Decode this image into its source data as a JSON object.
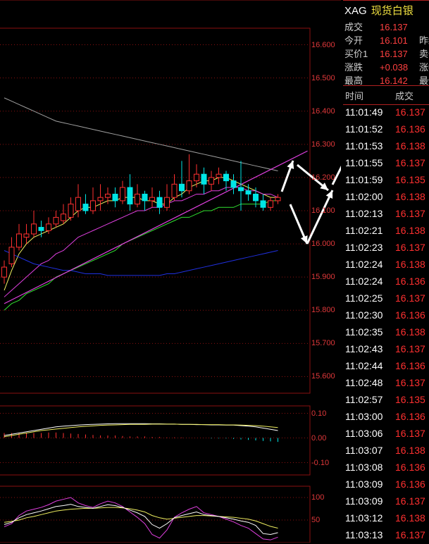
{
  "colors": {
    "up": "#ff3030",
    "down": "#00e5e5",
    "grid": "#8a1010",
    "axis": "#e0383a"
  },
  "header": {
    "symbol_code": "XAG",
    "symbol_name": "现货白银",
    "rows": [
      {
        "k": "成交",
        "v": "16.137",
        "x": ""
      },
      {
        "k": "今开",
        "v": "16.101",
        "x": "昨结"
      },
      {
        "k": "买价1",
        "v": "16.137",
        "x": "卖价"
      },
      {
        "k": "涨跌",
        "v": "+0.038",
        "x": "涨幅"
      },
      {
        "k": "最高",
        "v": "16.142",
        "x": "最低"
      }
    ]
  },
  "ticks_header": {
    "time": "时间",
    "price": "成交"
  },
  "ticks": [
    {
      "time": "11:01:49",
      "price": "16.137"
    },
    {
      "time": "11:01:52",
      "price": "16.136"
    },
    {
      "time": "11:01:53",
      "price": "16.138"
    },
    {
      "time": "11:01:55",
      "price": "16.137"
    },
    {
      "time": "11:01:59",
      "price": "16.135"
    },
    {
      "time": "11:02:00",
      "price": "16.138"
    },
    {
      "time": "11:02:13",
      "price": "16.137"
    },
    {
      "time": "11:02:21",
      "price": "16.138"
    },
    {
      "time": "11:02:23",
      "price": "16.137"
    },
    {
      "time": "11:02:24",
      "price": "16.138"
    },
    {
      "time": "11:02:24",
      "price": "16.136"
    },
    {
      "time": "11:02:25",
      "price": "16.137"
    },
    {
      "time": "11:02:30",
      "price": "16.136"
    },
    {
      "time": "11:02:35",
      "price": "16.138"
    },
    {
      "time": "11:02:43",
      "price": "16.137"
    },
    {
      "time": "11:02:44",
      "price": "16.136"
    },
    {
      "time": "11:02:48",
      "price": "16.137"
    },
    {
      "time": "11:02:57",
      "price": "16.135"
    },
    {
      "time": "11:03:00",
      "price": "16.136"
    },
    {
      "time": "11:03:06",
      "price": "16.137"
    },
    {
      "time": "11:03:07",
      "price": "16.138"
    },
    {
      "time": "11:03:08",
      "price": "16.136"
    },
    {
      "time": "11:03:09",
      "price": "16.136"
    },
    {
      "time": "11:03:09",
      "price": "16.137"
    },
    {
      "time": "11:03:12",
      "price": "16.138"
    },
    {
      "time": "11:03:13",
      "price": "16.137"
    }
  ],
  "price_axis": [
    "16.600",
    "16.500",
    "16.400",
    "16.300",
    "16.200",
    "16.100",
    "16.000",
    "15.900",
    "15.800",
    "15.700",
    "15.600"
  ],
  "macd_axis": [
    "0.10",
    "0.00",
    "-0.10"
  ],
  "kdj_axis": [
    "100",
    "50"
  ],
  "chart_data": {
    "type": "candlestick",
    "ylim": [
      15.55,
      16.65
    ],
    "candles": [
      [
        15.9,
        15.93,
        15.88,
        15.95
      ],
      [
        15.94,
        15.99,
        15.93,
        16.02
      ],
      [
        15.99,
        16.03,
        15.98,
        16.06
      ],
      [
        16.02,
        16.03,
        16.0,
        16.06
      ],
      [
        16.03,
        16.06,
        16.02,
        16.1
      ],
      [
        16.05,
        16.04,
        16.02,
        16.07
      ],
      [
        16.04,
        16.06,
        16.03,
        16.08
      ],
      [
        16.06,
        16.08,
        16.05,
        16.1
      ],
      [
        16.07,
        16.09,
        16.06,
        16.12
      ],
      [
        16.08,
        16.12,
        16.07,
        16.14
      ],
      [
        16.1,
        16.14,
        16.08,
        16.18
      ],
      [
        16.12,
        16.1,
        16.09,
        16.15
      ],
      [
        16.1,
        16.13,
        16.09,
        16.17
      ],
      [
        16.13,
        16.14,
        16.1,
        16.18
      ],
      [
        16.14,
        16.15,
        16.12,
        16.17
      ],
      [
        16.15,
        16.13,
        16.11,
        16.17
      ],
      [
        16.13,
        16.17,
        16.12,
        16.19
      ],
      [
        16.17,
        16.12,
        16.1,
        16.21
      ],
      [
        16.12,
        16.15,
        16.11,
        16.18
      ],
      [
        16.15,
        16.13,
        16.1,
        16.16
      ],
      [
        16.13,
        16.14,
        16.11,
        16.17
      ],
      [
        16.14,
        16.11,
        16.09,
        16.16
      ],
      [
        16.11,
        16.14,
        16.1,
        16.18
      ],
      [
        16.14,
        16.18,
        16.13,
        16.21
      ],
      [
        16.18,
        16.16,
        16.14,
        16.25
      ],
      [
        16.16,
        16.19,
        16.15,
        16.27
      ],
      [
        16.19,
        16.21,
        16.17,
        16.24
      ],
      [
        16.21,
        16.18,
        16.15,
        16.23
      ],
      [
        16.18,
        16.2,
        16.16,
        16.22
      ],
      [
        16.2,
        16.21,
        16.18,
        16.23
      ],
      [
        16.21,
        16.19,
        16.16,
        16.22
      ],
      [
        16.19,
        16.17,
        16.15,
        16.21
      ],
      [
        16.17,
        16.16,
        16.1,
        16.25
      ],
      [
        16.16,
        16.15,
        16.13,
        16.18
      ],
      [
        16.15,
        16.13,
        16.11,
        16.17
      ],
      [
        16.13,
        16.11,
        16.1,
        16.15
      ],
      [
        16.11,
        16.13,
        16.1,
        16.14
      ],
      [
        16.13,
        16.14,
        16.12,
        16.15
      ]
    ],
    "ma_lines": [
      {
        "color": "#f0f060",
        "values": [
          15.86,
          15.92,
          15.97,
          16.0,
          16.02,
          16.03,
          16.04,
          16.05,
          16.06,
          16.08,
          16.1,
          16.11,
          16.11,
          16.12,
          16.13,
          16.13,
          16.14,
          16.14,
          16.14,
          16.13,
          16.13,
          16.12,
          16.12,
          16.14,
          16.15,
          16.17,
          16.18,
          16.19,
          16.19,
          16.2,
          16.2,
          16.19,
          16.18,
          16.17,
          16.16,
          16.15,
          16.14,
          16.14
        ]
      },
      {
        "color": "#e040e0",
        "values": [
          15.84,
          15.86,
          15.88,
          15.9,
          15.92,
          15.94,
          15.95,
          15.97,
          15.98,
          16.0,
          16.02,
          16.03,
          16.04,
          16.05,
          16.06,
          16.07,
          16.08,
          16.09,
          16.1,
          16.1,
          16.11,
          16.11,
          16.12,
          16.13,
          16.13,
          16.14,
          16.15,
          16.15,
          16.16,
          16.16,
          16.17,
          16.17,
          16.17,
          16.16,
          16.16,
          16.15,
          16.15,
          16.14
        ]
      },
      {
        "color": "#30e030",
        "values": [
          15.8,
          15.82,
          15.83,
          15.85,
          15.86,
          15.87,
          15.88,
          15.9,
          15.91,
          15.92,
          15.93,
          15.94,
          15.95,
          15.96,
          15.97,
          15.98,
          16.0,
          16.01,
          16.02,
          16.03,
          16.04,
          16.05,
          16.06,
          16.07,
          16.08,
          16.08,
          16.09,
          16.1,
          16.1,
          16.11,
          16.11,
          16.11,
          16.12,
          16.12,
          16.12,
          16.12,
          16.13,
          16.13
        ]
      },
      {
        "color": "#2030e0",
        "values": [
          15.98,
          15.97,
          15.96,
          15.95,
          15.94,
          15.935,
          15.93,
          15.925,
          15.92,
          15.92,
          15.915,
          15.91,
          15.91,
          15.91,
          15.905,
          15.905,
          15.905,
          15.905,
          15.905,
          15.905,
          15.905,
          15.905,
          15.91,
          15.91,
          15.915,
          15.92,
          15.925,
          15.93,
          15.935,
          15.94,
          15.945,
          15.95,
          15.955,
          15.96,
          15.965,
          15.97,
          15.975,
          15.98
        ]
      },
      {
        "color": "#a0a0a0",
        "values": [
          16.44,
          16.43,
          16.42,
          16.41,
          16.4,
          16.39,
          16.38,
          16.37,
          16.365,
          16.36,
          16.355,
          16.35,
          16.345,
          16.34,
          16.335,
          16.33,
          16.325,
          16.32,
          16.315,
          16.31,
          16.305,
          16.3,
          16.295,
          16.29,
          16.285,
          16.28,
          16.275,
          16.27,
          16.265,
          16.26,
          16.255,
          16.25,
          16.245,
          16.24,
          16.235,
          16.23,
          16.225,
          16.22
        ]
      }
    ],
    "trendline": [
      [
        0,
        15.82
      ],
      [
        41,
        16.28
      ]
    ],
    "macd": {
      "ylim": [
        -0.15,
        0.13
      ],
      "dif": [
        0.01,
        0.015,
        0.02,
        0.025,
        0.03,
        0.035,
        0.04,
        0.045,
        0.048,
        0.05,
        0.052,
        0.054,
        0.055,
        0.056,
        0.057,
        0.058,
        0.058,
        0.058,
        0.058,
        0.058,
        0.057,
        0.057,
        0.056,
        0.056,
        0.055,
        0.055,
        0.054,
        0.054,
        0.053,
        0.053,
        0.052,
        0.052,
        0.05,
        0.048,
        0.045,
        0.04,
        0.035,
        0.03
      ],
      "dea": [
        0.005,
        0.01,
        0.015,
        0.02,
        0.025,
        0.03,
        0.033,
        0.036,
        0.039,
        0.042,
        0.045,
        0.047,
        0.049,
        0.051,
        0.052,
        0.053,
        0.054,
        0.055,
        0.055,
        0.055,
        0.056,
        0.056,
        0.056,
        0.056,
        0.055,
        0.055,
        0.055,
        0.054,
        0.054,
        0.054,
        0.053,
        0.053,
        0.052,
        0.051,
        0.05,
        0.048,
        0.045,
        0.042
      ],
      "hist": [
        0.02,
        0.02,
        0.02,
        0.02,
        0.02,
        0.02,
        0.022,
        0.022,
        0.02,
        0.018,
        0.016,
        0.014,
        0.012,
        0.01,
        0.01,
        0.01,
        0.008,
        0.006,
        0.006,
        0.006,
        0.004,
        0.004,
        0.002,
        0.002,
        0.002,
        0.0,
        0.0,
        0.0,
        -0.002,
        -0.002,
        -0.002,
        -0.004,
        -0.006,
        -0.008,
        -0.01,
        -0.012,
        -0.014,
        -0.016
      ]
    },
    "kdj": {
      "ylim": [
        0,
        125
      ],
      "k": [
        40,
        45,
        55,
        62,
        66,
        70,
        75,
        80,
        82,
        85,
        80,
        78,
        76,
        80,
        84,
        82,
        78,
        72,
        66,
        58,
        40,
        32,
        42,
        55,
        60,
        64,
        68,
        62,
        60,
        58,
        55,
        52,
        48,
        45,
        38,
        20,
        18,
        22
      ],
      "d": [
        45,
        47,
        50,
        55,
        58,
        62,
        66,
        70,
        72,
        74,
        75,
        76,
        76,
        77,
        78,
        78,
        77,
        75,
        72,
        68,
        60,
        55,
        52,
        54,
        56,
        58,
        60,
        60,
        59,
        58,
        57,
        56,
        54,
        52,
        48,
        42,
        36,
        32
      ],
      "j": [
        35,
        42,
        60,
        70,
        74,
        78,
        84,
        92,
        96,
        100,
        88,
        82,
        78,
        86,
        92,
        88,
        80,
        68,
        56,
        42,
        18,
        10,
        28,
        56,
        66,
        74,
        80,
        66,
        62,
        58,
        52,
        46,
        38,
        32,
        20,
        8,
        6,
        12
      ]
    }
  }
}
